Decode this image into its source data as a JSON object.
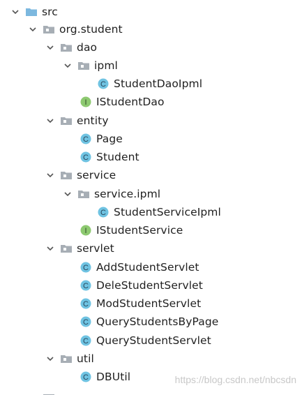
{
  "tree": {
    "items": [
      {
        "label": "src",
        "type": "folder-source",
        "expanded": true
      },
      {
        "label": "org.student",
        "type": "package",
        "expanded": true
      },
      {
        "label": "dao",
        "type": "package",
        "expanded": true
      },
      {
        "label": "ipml",
        "type": "package",
        "expanded": true
      },
      {
        "label": "StudentDaoIpml",
        "type": "class"
      },
      {
        "label": "IStudentDao",
        "type": "interface"
      },
      {
        "label": "entity",
        "type": "package",
        "expanded": true
      },
      {
        "label": "Page",
        "type": "class"
      },
      {
        "label": "Student",
        "type": "class"
      },
      {
        "label": "service",
        "type": "package",
        "expanded": true
      },
      {
        "label": "service.ipml",
        "type": "package",
        "expanded": true
      },
      {
        "label": "StudentServiceIpml",
        "type": "class"
      },
      {
        "label": "IStudentService",
        "type": "interface"
      },
      {
        "label": "servlet",
        "type": "package",
        "expanded": true
      },
      {
        "label": "AddStudentServlet",
        "type": "class"
      },
      {
        "label": "DeleStudentServlet",
        "type": "class"
      },
      {
        "label": "ModStudentServlet",
        "type": "class"
      },
      {
        "label": "QueryStudentsByPage",
        "type": "class"
      },
      {
        "label": "QueryStudentServlet",
        "type": "class"
      },
      {
        "label": "util",
        "type": "package",
        "expanded": true
      },
      {
        "label": "DBUtil",
        "type": "class"
      }
    ]
  },
  "watermark": "https://blog.csdn.net/nbcsdn",
  "colors": {
    "class_icon": "#6fc3e2",
    "interface_icon": "#8dc970",
    "folder_source": "#7cb8df",
    "package_folder": "#a7aeb5",
    "chevron": "#555555"
  }
}
